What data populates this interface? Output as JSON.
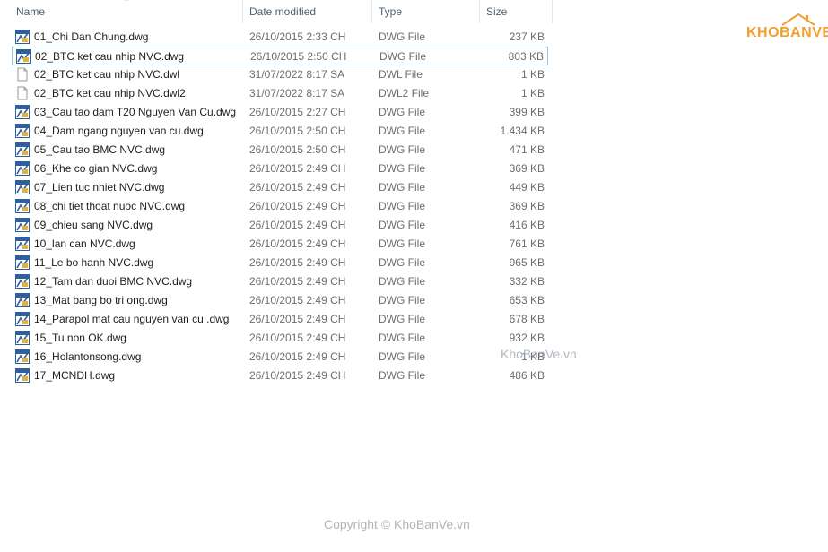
{
  "columns": {
    "name": "Name",
    "date": "Date modified",
    "type": "Type",
    "size": "Size"
  },
  "files": [
    {
      "name": "01_Chi Dan Chung.dwg",
      "date": "26/10/2015 2:33 CH",
      "type": "DWG File",
      "size": "237 KB",
      "icon": "dwg-file-icon"
    },
    {
      "name": "02_BTC ket cau nhip NVC.dwg",
      "date": "26/10/2015 2:50 CH",
      "type": "DWG File",
      "size": "803 KB",
      "icon": "dwg-file-icon"
    },
    {
      "name": "02_BTC ket cau nhip NVC.dwl",
      "date": "31/07/2022 8:17 SA",
      "type": "DWL File",
      "size": "1 KB",
      "icon": "blank-file-icon"
    },
    {
      "name": "02_BTC ket cau nhip NVC.dwl2",
      "date": "31/07/2022 8:17 SA",
      "type": "DWL2 File",
      "size": "1 KB",
      "icon": "blank-file-icon"
    },
    {
      "name": "03_Cau tao dam T20 Nguyen Van Cu.dwg",
      "date": "26/10/2015 2:27 CH",
      "type": "DWG File",
      "size": "399 KB",
      "icon": "dwg-file-icon"
    },
    {
      "name": "04_Dam ngang nguyen van cu.dwg",
      "date": "26/10/2015 2:50 CH",
      "type": "DWG File",
      "size": "1.434 KB",
      "icon": "dwg-file-icon"
    },
    {
      "name": "05_Cau tao BMC NVC.dwg",
      "date": "26/10/2015 2:50 CH",
      "type": "DWG File",
      "size": "471 KB",
      "icon": "dwg-file-icon"
    },
    {
      "name": "06_Khe co gian NVC.dwg",
      "date": "26/10/2015 2:49 CH",
      "type": "DWG File",
      "size": "369 KB",
      "icon": "dwg-file-icon"
    },
    {
      "name": "07_Lien tuc nhiet NVC.dwg",
      "date": "26/10/2015 2:49 CH",
      "type": "DWG File",
      "size": "449 KB",
      "icon": "dwg-file-icon"
    },
    {
      "name": "08_chi tiet thoat nuoc NVC.dwg",
      "date": "26/10/2015 2:49 CH",
      "type": "DWG File",
      "size": "369 KB",
      "icon": "dwg-file-icon"
    },
    {
      "name": "09_chieu sang NVC.dwg",
      "date": "26/10/2015 2:49 CH",
      "type": "DWG File",
      "size": "416 KB",
      "icon": "dwg-file-icon"
    },
    {
      "name": "10_lan can NVC.dwg",
      "date": "26/10/2015 2:49 CH",
      "type": "DWG File",
      "size": "761 KB",
      "icon": "dwg-file-icon"
    },
    {
      "name": "11_Le bo hanh NVC.dwg",
      "date": "26/10/2015 2:49 CH",
      "type": "DWG File",
      "size": "965 KB",
      "icon": "dwg-file-icon"
    },
    {
      "name": "12_Tam dan duoi BMC NVC.dwg",
      "date": "26/10/2015 2:49 CH",
      "type": "DWG File",
      "size": "332 KB",
      "icon": "dwg-file-icon"
    },
    {
      "name": "13_Mat bang bo tri ong.dwg",
      "date": "26/10/2015 2:49 CH",
      "type": "DWG File",
      "size": "653 KB",
      "icon": "dwg-file-icon"
    },
    {
      "name": "14_Parapol mat cau nguyen van cu .dwg",
      "date": "26/10/2015 2:49 CH",
      "type": "DWG File",
      "size": "678 KB",
      "icon": "dwg-file-icon"
    },
    {
      "name": "15_Tu non OK.dwg",
      "date": "26/10/2015 2:49 CH",
      "type": "DWG File",
      "size": "932 KB",
      "icon": "dwg-file-icon"
    },
    {
      "name": "16_Holantonsong.dwg",
      "date": "26/10/2015 2:49 CH",
      "type": "DWG File",
      "size": "1 KB",
      "icon": "dwg-file-icon"
    },
    {
      "name": "17_MCNDH.dwg",
      "date": "26/10/2015 2:49 CH",
      "type": "DWG File",
      "size": "486 KB",
      "icon": "dwg-file-icon"
    }
  ],
  "selected_index": 1,
  "logo": "KHOBANVE",
  "watermark": "KhoBanVe.vn",
  "copyright": "Copyright © KhoBanVe.vn",
  "colors": {
    "header_text": "#4c607a",
    "selection_border": "#99c9ef",
    "logo": "#f0a030"
  }
}
